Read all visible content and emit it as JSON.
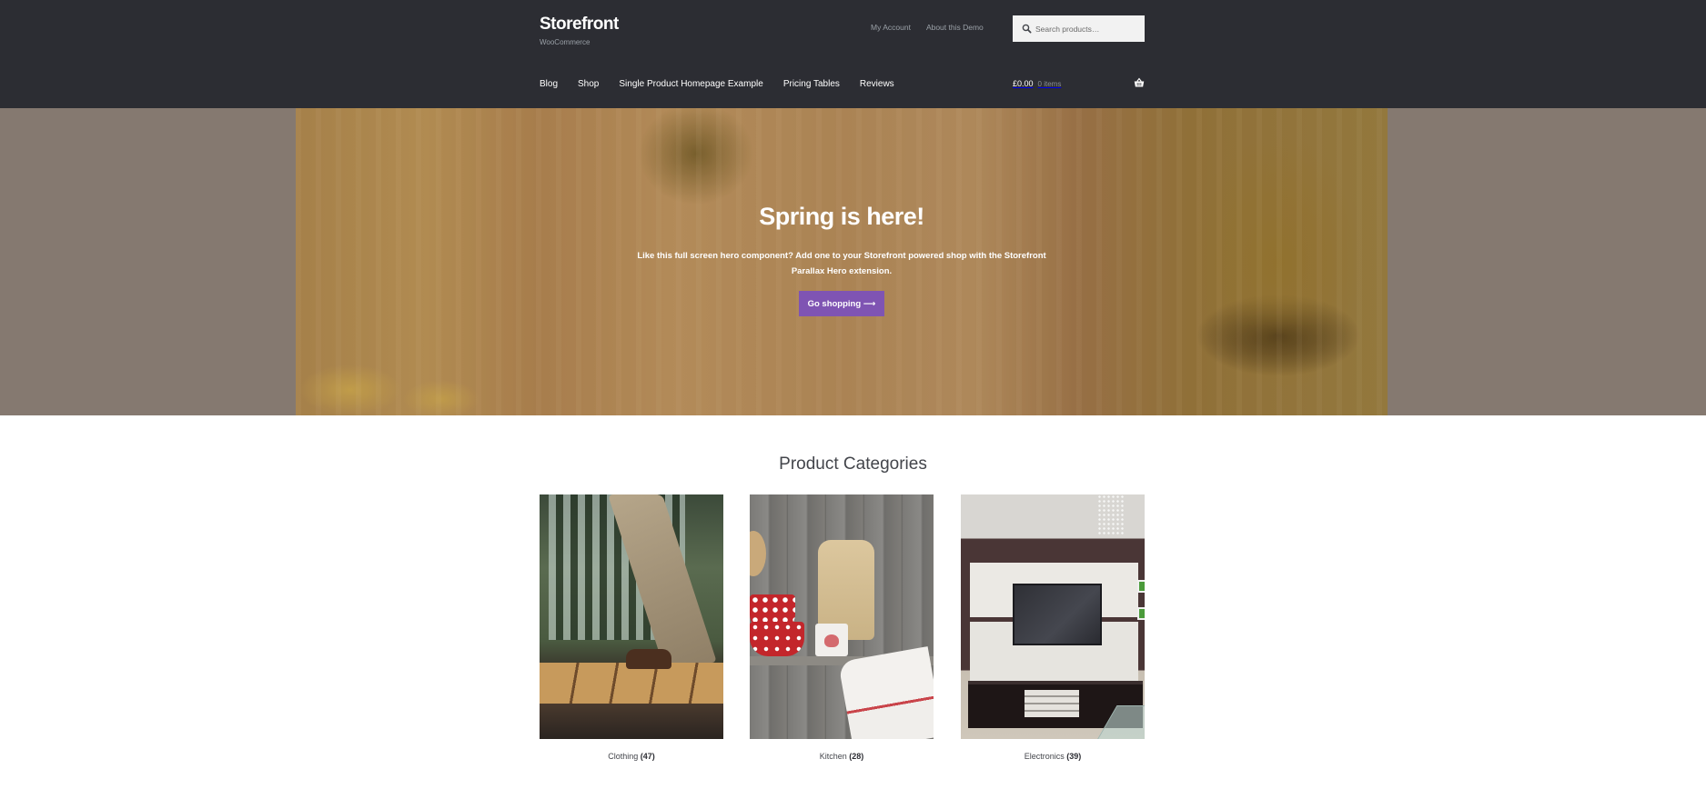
{
  "header": {
    "site_title": "Storefront",
    "site_description": "WooCommerce",
    "secondary_nav": [
      {
        "label": "My Account"
      },
      {
        "label": "About this Demo"
      }
    ],
    "search": {
      "placeholder": "Search products…",
      "value": "",
      "icon": "search-icon"
    },
    "primary_nav": [
      {
        "label": "Blog"
      },
      {
        "label": "Shop"
      },
      {
        "label": "Single Product Homepage Example"
      },
      {
        "label": "Pricing Tables"
      },
      {
        "label": "Reviews"
      }
    ],
    "cart": {
      "amount": "£0.00",
      "count": "0 items",
      "icon": "basket-icon"
    },
    "colors": {
      "background": "#2c2d33"
    }
  },
  "hero": {
    "title": "Spring is here!",
    "text": "Like this full screen hero component? Add one to your Storefront powered shop with the Storefront Parallax Hero extension.",
    "button_label": "Go shopping ⟶",
    "colors": {
      "button": "#7f54b3",
      "side_background": "#857970"
    }
  },
  "categories": {
    "title": "Product Categories",
    "items": [
      {
        "name": "Clothing",
        "count": "(47)"
      },
      {
        "name": "Kitchen",
        "count": "(28)"
      },
      {
        "name": "Electronics",
        "count": "(39)"
      }
    ]
  }
}
